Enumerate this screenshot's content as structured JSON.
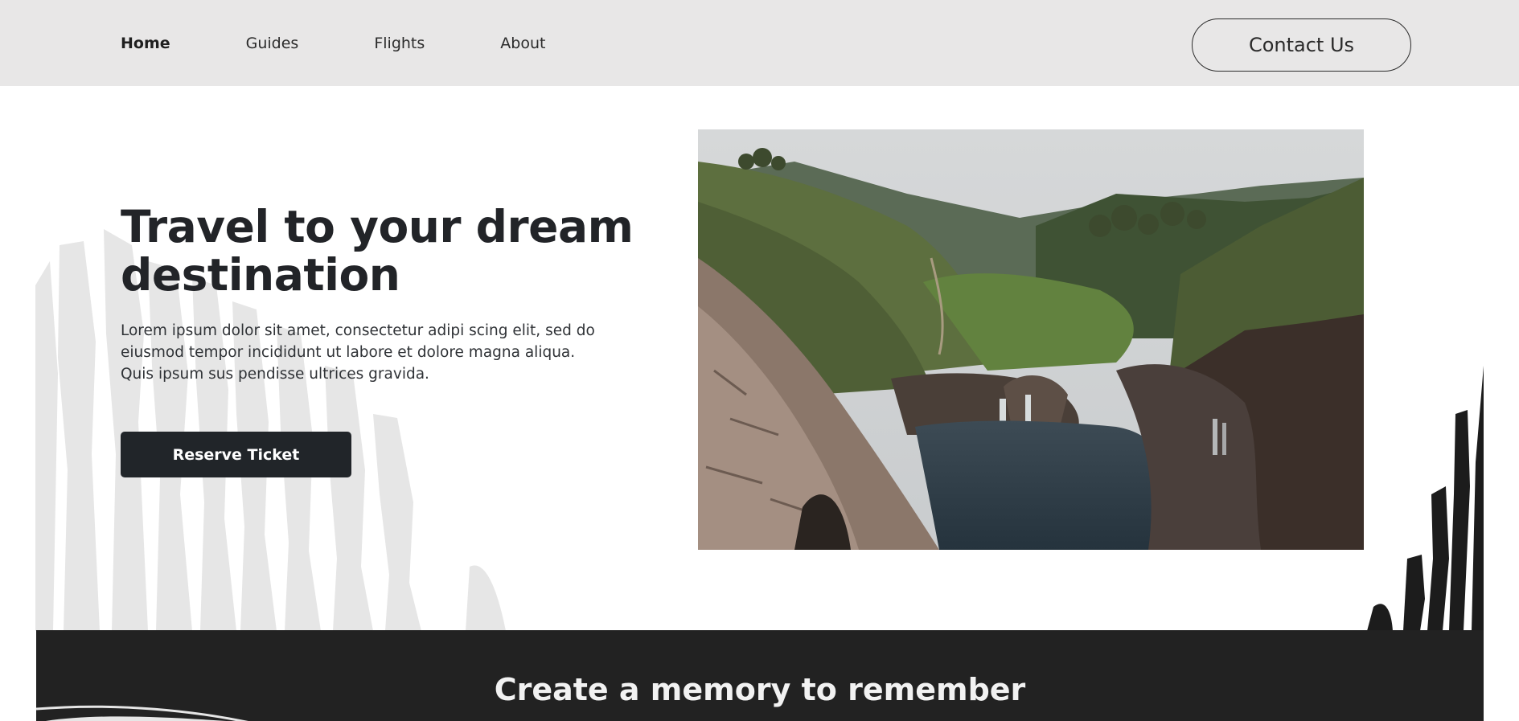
{
  "nav": {
    "links": [
      {
        "label": "Home",
        "active": true
      },
      {
        "label": "Guides",
        "active": false
      },
      {
        "label": "Flights",
        "active": false
      },
      {
        "label": "About",
        "active": false
      }
    ],
    "contact_label": "Contact Us"
  },
  "hero": {
    "title": "Travel to your dream destination",
    "text": "Lorem ipsum dolor sit amet, consectetur adipi scing elit, sed do eiusmod tempor incididunt ut labore et dolore magna aliqua. Quis ipsum sus pendisse ultrices gravida.",
    "button_label": "Reserve Ticket"
  },
  "section": {
    "title": "Create a memory to remember"
  },
  "colors": {
    "nav_bg": "#e8e7e7",
    "primary_dark": "#212529",
    "section_bg": "#222222",
    "brush_light": "#e6e6e6"
  }
}
